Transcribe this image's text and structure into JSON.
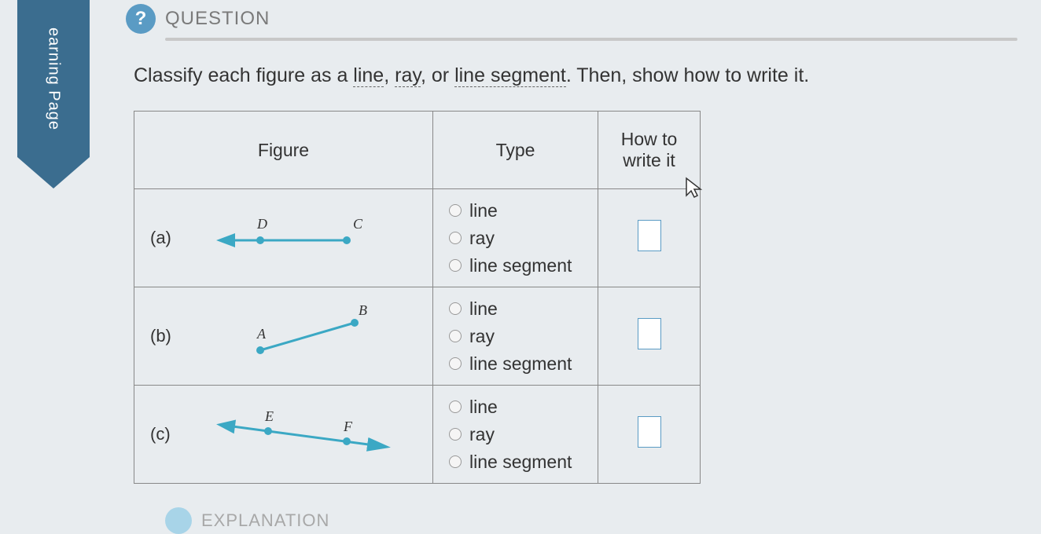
{
  "sideTab": "earning Page",
  "header": {
    "iconChar": "?",
    "title": "QUESTION"
  },
  "instruction": {
    "prefix": "Classify each figure as a ",
    "term1": "line",
    "sep1": ", ",
    "term2": "ray",
    "sep2": ", or ",
    "term3": "line segment",
    "suffix": ". Then, show how to write it."
  },
  "table": {
    "headers": {
      "figure": "Figure",
      "type": "Type",
      "write": "How to write it"
    },
    "rows": [
      {
        "label": "(a)",
        "points": [
          "D",
          "C"
        ],
        "figureType": "ray-left",
        "options": [
          "line",
          "ray",
          "line segment"
        ]
      },
      {
        "label": "(b)",
        "points": [
          "A",
          "B"
        ],
        "figureType": "segment",
        "options": [
          "line",
          "ray",
          "line segment"
        ]
      },
      {
        "label": "(c)",
        "points": [
          "E",
          "F"
        ],
        "figureType": "line",
        "options": [
          "line",
          "ray",
          "line segment"
        ]
      }
    ]
  },
  "footer": {
    "title": "EXPLANATION"
  }
}
